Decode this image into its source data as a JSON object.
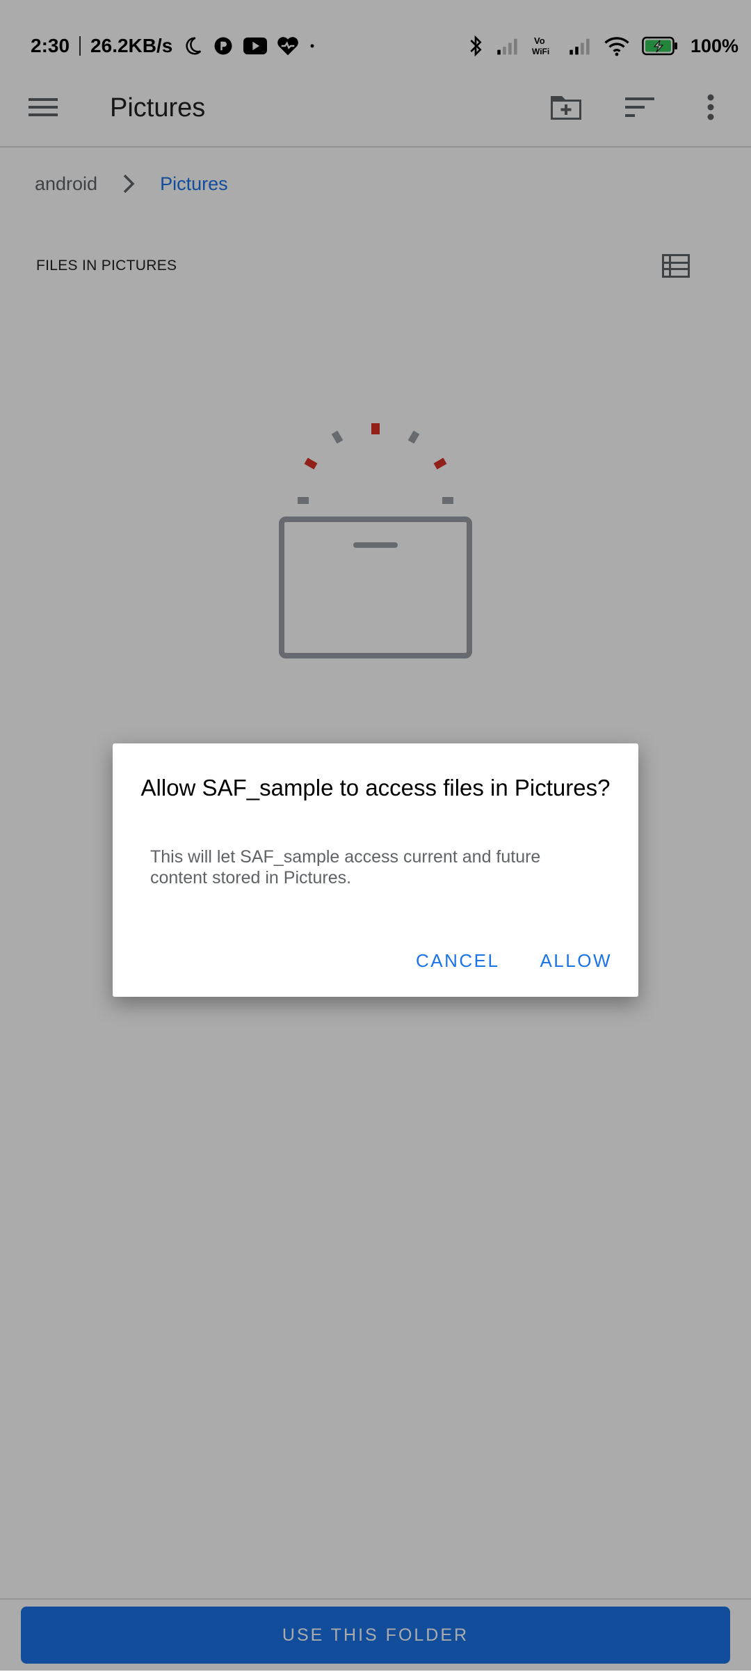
{
  "status_bar": {
    "time": "2:30",
    "net_speed": "26.2KB/s",
    "battery": "100%",
    "vowifi": "Vo\nWiFi"
  },
  "toolbar": {
    "title": "Pictures"
  },
  "breadcrumb": {
    "root": "android",
    "current": "Pictures"
  },
  "section": {
    "header": "FILES IN PICTURES"
  },
  "dialog": {
    "title": "Allow SAF_sample to access files in Pictures?",
    "message": "This will let SAF_sample access current and future content stored in Pictures.",
    "cancel_label": "CANCEL",
    "allow_label": "ALLOW"
  },
  "bottom": {
    "use_folder_label": "USE THIS FOLDER"
  },
  "colors": {
    "accent": "#1a73e8",
    "illustration_red": "#d93025",
    "illustration_gray": "#9aa0a6"
  }
}
